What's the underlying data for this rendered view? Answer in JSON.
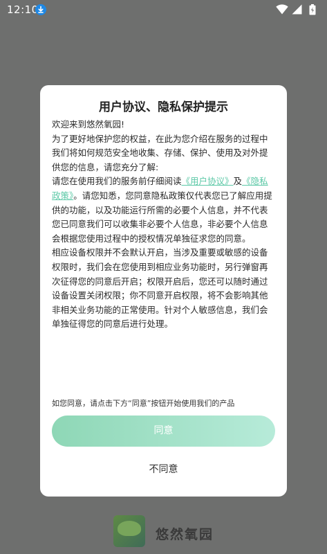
{
  "status_bar": {
    "time": "12:10"
  },
  "dialog": {
    "title": "用户协议、隐私保护提示",
    "paragraphs": {
      "p1": "欢迎来到悠然氧园!",
      "p2": "为了更好地保护您的权益，在此为您介绍在服务的过程中我们将如何规范安全地收集、存储、保护、使用及对外提供您的信息，请您充分了解:",
      "p3_before": "请您在使用我们的服务前仔细阅读",
      "link_user_agreement": "《用户协议》",
      "p3_and": "及",
      "link_privacy_policy": "《隐私政策》",
      "p3_after": "。请您知悉，您同意隐私政策仅代表您已了解应用提供的功能，以及功能运行所需的必要个人信息，并不代表您已同意我们可以收集非必要个人信息，非必要个人信息会根据您使用过程中的授权情况单独征求您的同意。",
      "p4": "相应设备权限并不会默认开启，当涉及重要或敏感的设备权限时，我们会在您使用到相应业务功能时，另行弹窗再次征得您的同意后开启；权限开启后，您还可以随时通过设备设置关闭权限；你不同意开启权限，将不会影响其他非相关业务功能的正常使用。针对个人敏感信息，我们会单独征得您的同意后进行处理。"
    },
    "consent_hint": "如您同意，请点击下方“同意”按钮开始使用我们的产品",
    "agree_label": "同意",
    "disagree_label": "不同意"
  },
  "splash": {
    "app_name": "悠然氧园"
  },
  "colors": {
    "overlay": "#6e6f6e",
    "accent_link": "#5bc8a6",
    "agree_gradient_start": "#8ed7b6",
    "agree_gradient_end": "#b7ebd9"
  },
  "icons": [
    "download-icon",
    "wifi-icon",
    "signal-icon",
    "battery-icon",
    "app-logo"
  ]
}
